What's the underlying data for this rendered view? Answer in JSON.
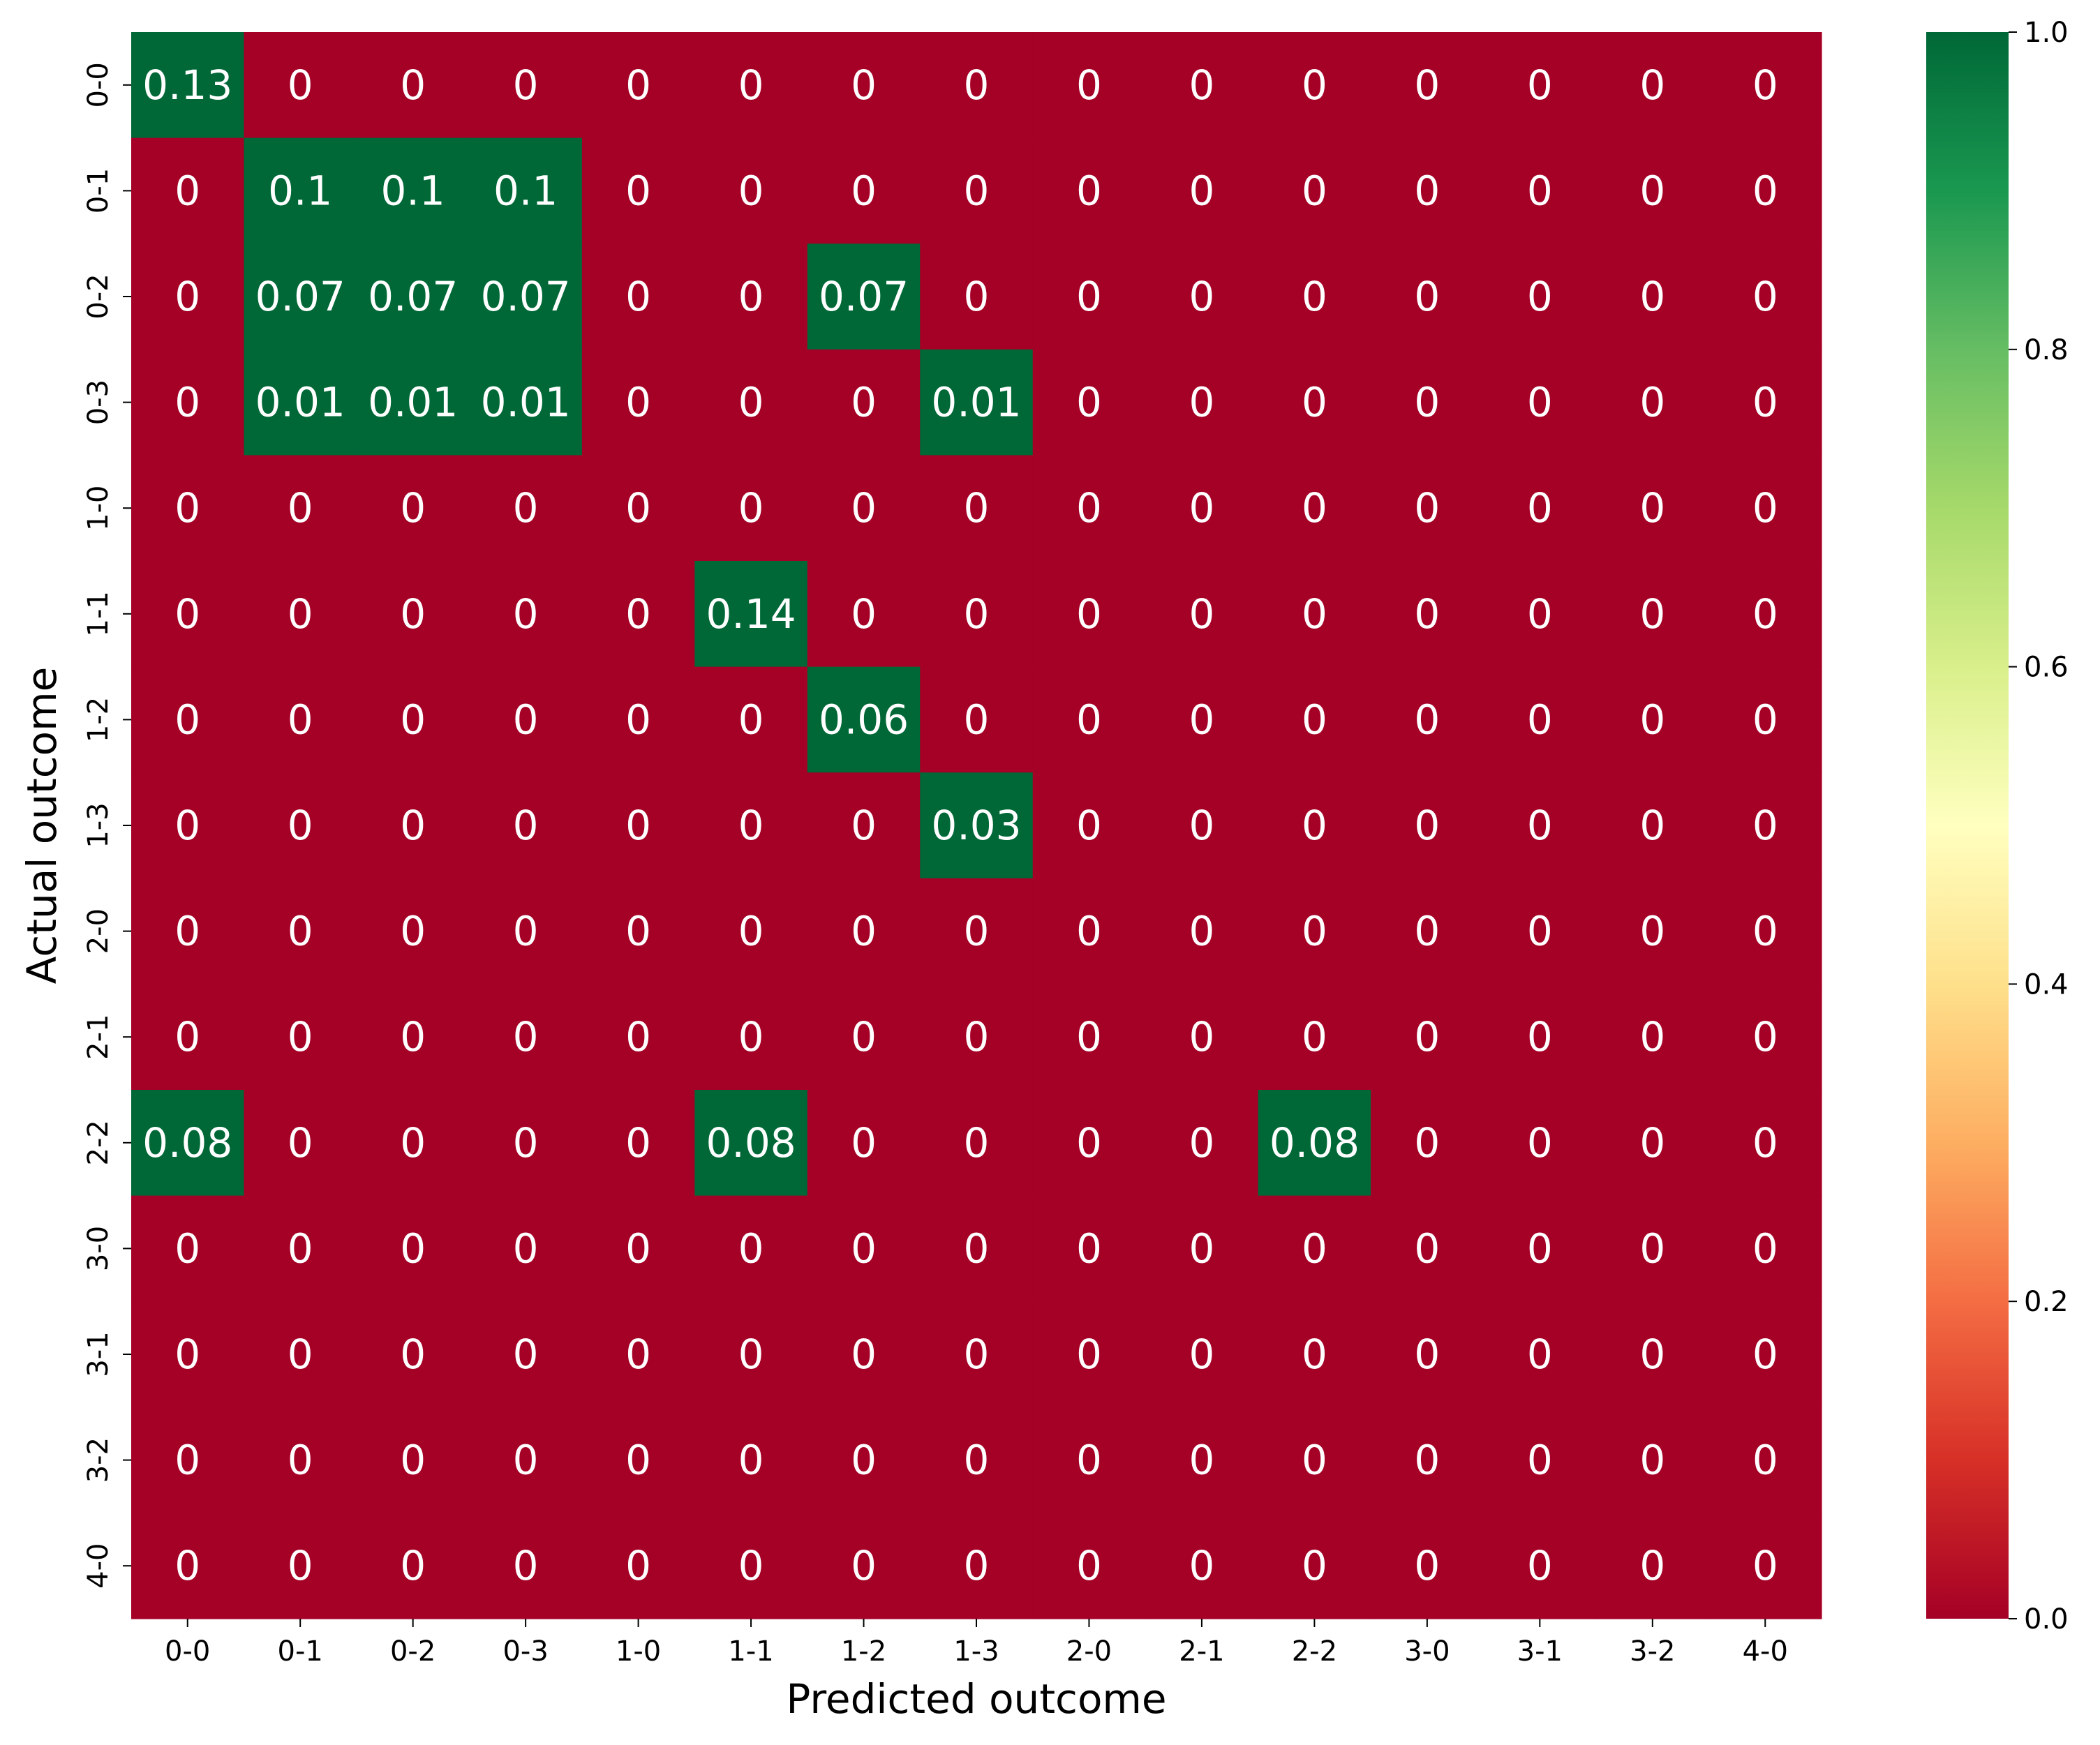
{
  "chart_data": {
    "type": "heatmap",
    "title": "",
    "xlabel": "Predicted outcome",
    "ylabel": "Actual outcome",
    "x_categories": [
      "0-0",
      "0-1",
      "0-2",
      "0-3",
      "1-0",
      "1-1",
      "1-2",
      "1-3",
      "2-0",
      "2-1",
      "2-2",
      "3-0",
      "3-1",
      "3-2",
      "4-0"
    ],
    "y_categories": [
      "0-0",
      "0-1",
      "0-2",
      "0-3",
      "1-0",
      "1-1",
      "1-2",
      "1-3",
      "2-0",
      "2-1",
      "2-2",
      "3-0",
      "3-1",
      "3-2",
      "4-0"
    ],
    "values": [
      [
        0.13,
        0,
        0,
        0,
        0,
        0,
        0,
        0,
        0,
        0,
        0,
        0,
        0,
        0,
        0
      ],
      [
        0,
        0.1,
        0.1,
        0.1,
        0,
        0,
        0,
        0,
        0,
        0,
        0,
        0,
        0,
        0,
        0
      ],
      [
        0,
        0.07,
        0.07,
        0.07,
        0,
        0,
        0.07,
        0,
        0,
        0,
        0,
        0,
        0,
        0,
        0
      ],
      [
        0,
        0.01,
        0.01,
        0.01,
        0,
        0,
        0,
        0.01,
        0,
        0,
        0,
        0,
        0,
        0,
        0
      ],
      [
        0,
        0,
        0,
        0,
        0,
        0,
        0,
        0,
        0,
        0,
        0,
        0,
        0,
        0,
        0
      ],
      [
        0,
        0,
        0,
        0,
        0,
        0.14,
        0,
        0,
        0,
        0,
        0,
        0,
        0,
        0,
        0
      ],
      [
        0,
        0,
        0,
        0,
        0,
        0,
        0.06,
        0,
        0,
        0,
        0,
        0,
        0,
        0,
        0
      ],
      [
        0,
        0,
        0,
        0,
        0,
        0,
        0,
        0.03,
        0,
        0,
        0,
        0,
        0,
        0,
        0
      ],
      [
        0,
        0,
        0,
        0,
        0,
        0,
        0,
        0,
        0,
        0,
        0,
        0,
        0,
        0,
        0
      ],
      [
        0,
        0,
        0,
        0,
        0,
        0,
        0,
        0,
        0,
        0,
        0,
        0,
        0,
        0,
        0
      ],
      [
        0.08,
        0,
        0,
        0,
        0,
        0.08,
        0,
        0,
        0,
        0,
        0.08,
        0,
        0,
        0,
        0
      ],
      [
        0,
        0,
        0,
        0,
        0,
        0,
        0,
        0,
        0,
        0,
        0,
        0,
        0,
        0,
        0
      ],
      [
        0,
        0,
        0,
        0,
        0,
        0,
        0,
        0,
        0,
        0,
        0,
        0,
        0,
        0,
        0
      ],
      [
        0,
        0,
        0,
        0,
        0,
        0,
        0,
        0,
        0,
        0,
        0,
        0,
        0,
        0,
        0
      ],
      [
        0,
        0,
        0,
        0,
        0,
        0,
        0,
        0,
        0,
        0,
        0,
        0,
        0,
        0,
        0
      ]
    ],
    "colorbar": {
      "range": [
        0.0,
        1.0
      ],
      "ticks": [
        "0.0",
        "0.2",
        "0.4",
        "0.6",
        "0.8",
        "1.0"
      ],
      "colormap": "RdYlGn",
      "low_color": "#a50026",
      "high_color": "#006837"
    },
    "cell_colors": {
      "nonzero": "#006837",
      "zero": "#a50026",
      "text": "#ffffff"
    },
    "grid": false,
    "legend": "colorbar-right"
  }
}
